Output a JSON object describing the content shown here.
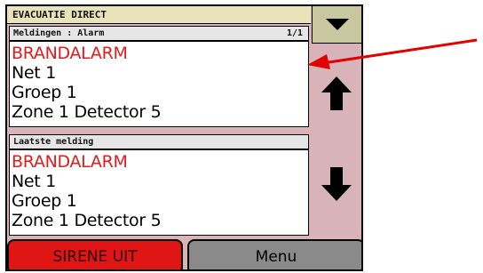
{
  "title": "EVACUATIE DIRECT",
  "panels": {
    "top": {
      "header": "Meldingen : Alarm",
      "count": "1/1",
      "lines": [
        "BRANDALARM",
        "Net 1",
        "Groep 1",
        "Zone 1 Detector 5"
      ]
    },
    "bottom": {
      "header": "Laatste melding",
      "lines": [
        "BRANDALARM",
        "Net 1",
        "Groep 1",
        "Zone 1 Detector 5"
      ]
    }
  },
  "buttons": {
    "sirene_off": "SIRENE UIT",
    "menu": "Menu"
  },
  "icons": {
    "scroll_down_top": "triangle-down-icon",
    "scroll_up": "arrow-up-icon",
    "scroll_down": "arrow-down-icon",
    "annotation": "red-arrow-annotation"
  },
  "colors": {
    "screen_background": "#d8b4b8",
    "title_bar": "#e8e3b8",
    "alarm_text": "#e31b1b",
    "sirene_button": "#e01515",
    "menu_button": "#8a8a8a",
    "annotation_arrow": "#e00000"
  }
}
